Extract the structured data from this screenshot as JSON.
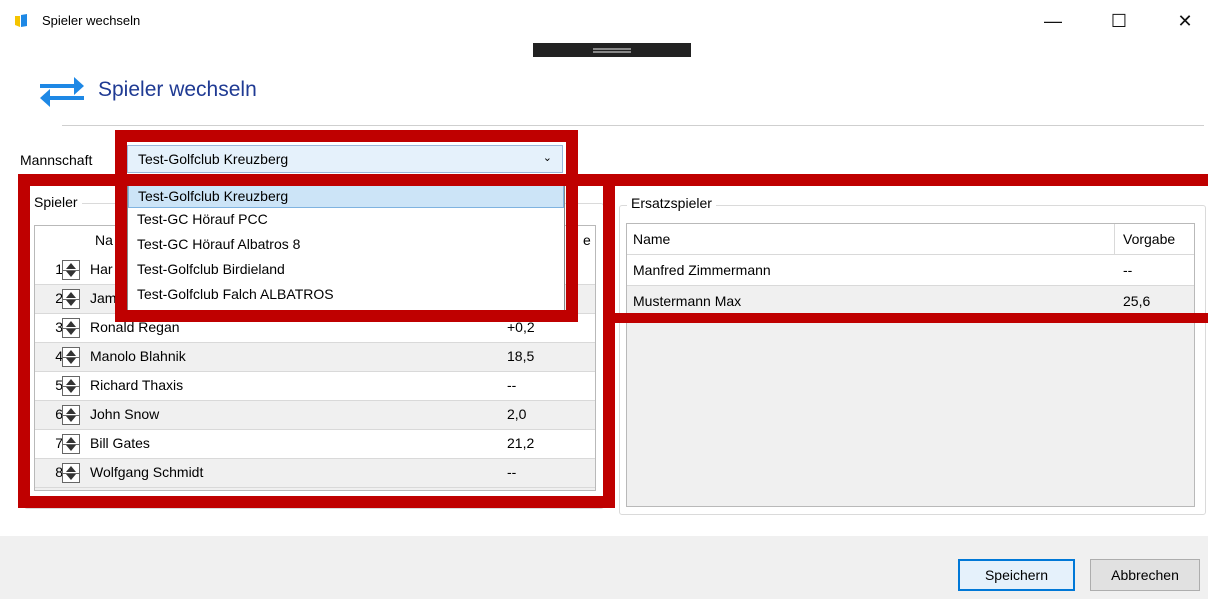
{
  "window": {
    "title": "Spieler wechseln",
    "controls": {
      "minimize": "—",
      "maximize": "☐",
      "close": "✕"
    }
  },
  "header": {
    "title": "Spieler wechseln",
    "icon": "swap-arrows-icon"
  },
  "team": {
    "label": "Mannschaft",
    "selected": "Test-Golfclub Kreuzberg",
    "options": [
      "Test-Golfclub Kreuzberg",
      "Test-GC Hörauf PCC",
      "Test-GC Hörauf Albatros 8",
      "Test-Golfclub Birdieland",
      "Test-Golfclub Falch ALBATROS"
    ]
  },
  "players": {
    "caption": "Spieler",
    "columns": {
      "name": "Na",
      "handicap": "e"
    },
    "rows": [
      {
        "num": "1",
        "name": "Har",
        "handicap": ""
      },
      {
        "num": "2",
        "name": "Jam",
        "handicap": ""
      },
      {
        "num": "3",
        "name": "Ronald Regan",
        "handicap": "+0,2"
      },
      {
        "num": "4",
        "name": "Manolo Blahnik",
        "handicap": "18,5"
      },
      {
        "num": "5",
        "name": "Richard Thaxis",
        "handicap": "--"
      },
      {
        "num": "6",
        "name": "John Snow",
        "handicap": "2,0"
      },
      {
        "num": "7",
        "name": "Bill Gates",
        "handicap": "21,2"
      },
      {
        "num": "8",
        "name": "Wolfgang Schmidt",
        "handicap": "--"
      }
    ]
  },
  "substitutes": {
    "caption": "Ersatzspieler",
    "columns": {
      "name": "Name",
      "handicap": "Vorgabe"
    },
    "rows": [
      {
        "name": "Manfred Zimmermann",
        "handicap": "--"
      },
      {
        "name": "Mustermann Max",
        "handicap": "25,6"
      }
    ]
  },
  "footer": {
    "save": "Speichern",
    "cancel": "Abbrechen"
  },
  "colors": {
    "accent": "#0078d7",
    "title": "#1f3a93",
    "annotation": "#bf0000",
    "icon": "#1e88e5"
  }
}
